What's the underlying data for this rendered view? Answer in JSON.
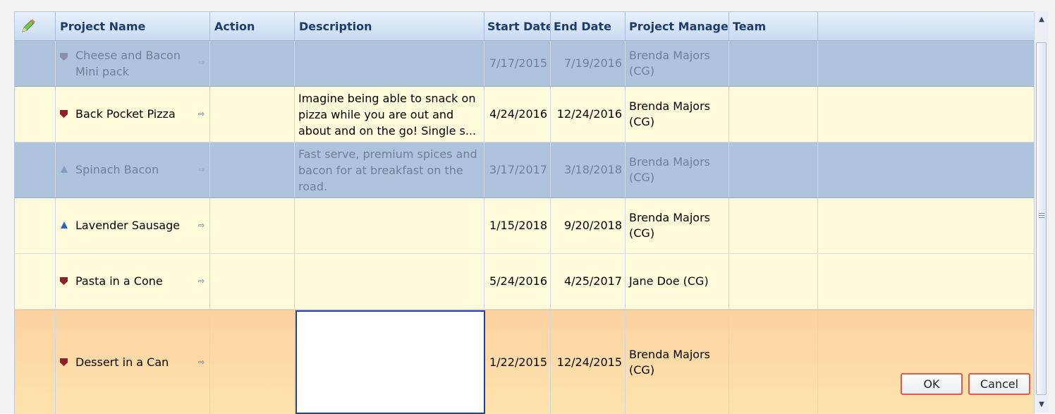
{
  "header": {
    "edit_icon": "pencil-icon",
    "columns": {
      "project_name": "Project Name",
      "action": "Action",
      "description": "Description",
      "start_date": "Start Date",
      "end_date": "End Date",
      "project_manager": "Project Manager",
      "team": "Team"
    }
  },
  "rows": [
    {
      "name_line1": "Cheese and Bacon",
      "name_line2": "Mini pack",
      "icon": "shield-icon",
      "description": "",
      "start": "7/17/2015",
      "end": "7/19/2016",
      "pm_line1": "Brenda Majors",
      "pm_line2": "(CG)",
      "team": "",
      "state": "dimmed"
    },
    {
      "name": "Back Pocket Pizza",
      "icon": "shield-icon",
      "desc_line1": "Imagine being able to snack on",
      "desc_line2": "pizza while you are out and",
      "desc_line3": "about and on the go! Single s...",
      "start": "4/24/2016",
      "end": "12/24/2016",
      "pm_line1": "Brenda Majors",
      "pm_line2": "(CG)",
      "team": "",
      "state": "normal"
    },
    {
      "name": "Spinach Bacon",
      "icon": "wedge-icon",
      "desc_line1": "Fast serve, premium spices and",
      "desc_line2": "bacon for at breakfast on the",
      "desc_line3": "road.",
      "start": "3/17/2017",
      "end": "3/18/2018",
      "pm_line1": "Brenda Majors",
      "pm_line2": "(CG)",
      "team": "",
      "state": "dimmed"
    },
    {
      "name": "Lavender Sausage",
      "icon": "wedge-icon",
      "description": "",
      "start": "1/15/2018",
      "end": "9/20/2018",
      "pm_line1": "Brenda Majors",
      "pm_line2": "(CG)",
      "team": "",
      "state": "normal"
    },
    {
      "name": "Pasta in a Cone",
      "icon": "shield-icon",
      "description": "",
      "start": "5/24/2016",
      "end": "4/25/2017",
      "pm": "Jane Doe (CG)",
      "team": "",
      "state": "normal"
    },
    {
      "name": "Dessert in a Can",
      "icon": "shield-icon",
      "description": "",
      "start": "1/22/2015",
      "end": "12/24/2015",
      "pm_line1": "Brenda Majors",
      "pm_line2": "(CG)",
      "team": "",
      "state": "editing"
    }
  ],
  "row_icons": {
    "action_link": "hierarchy-link-icon"
  },
  "buttons": {
    "ok": "OK",
    "cancel": "Cancel"
  },
  "colors": {
    "row_dimmed": "#aec4dd",
    "row_normal": "#fffbdb",
    "row_editing": "#fcd7a4",
    "header_gradient_top": "#e9f1fc",
    "header_gradient_bottom": "#c7daf1",
    "edit_border": "#1b3fb6",
    "button_border": "#e05a4a"
  }
}
